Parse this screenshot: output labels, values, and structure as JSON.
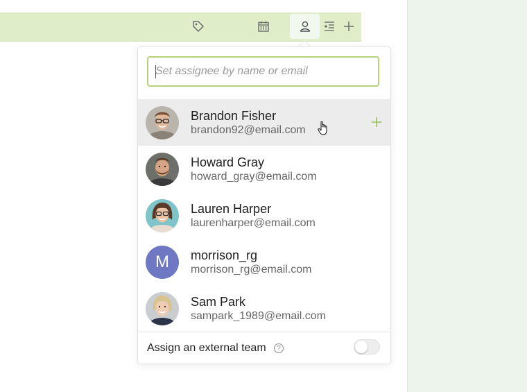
{
  "toolbar": {
    "icons": [
      "tag-icon",
      "calendar-icon",
      "person-icon",
      "list-indent-icon",
      "plus-icon"
    ],
    "active": "person-icon",
    "bg_color": "#dfeec8"
  },
  "assignee_picker": {
    "search_placeholder": "Set assignee by name or email",
    "search_value": "",
    "accent_color": "#b4d27d",
    "hovered_index": 0,
    "people": [
      {
        "name": "Brandon Fisher",
        "email": "brandon92@email.com",
        "avatar": "photo"
      },
      {
        "name": "Howard Gray",
        "email": "howard_gray@email.com",
        "avatar": "photo"
      },
      {
        "name": "Lauren Harper",
        "email": "laurenharper@email.com",
        "avatar": "photo"
      },
      {
        "name": "morrison_rg",
        "email": "morrison_rg@email.com",
        "avatar": "M",
        "avatar_color": "#6f78c2"
      },
      {
        "name": "Sam Park",
        "email": "sampark_1989@email.com",
        "avatar": "photo"
      }
    ],
    "footer": {
      "label": "Assign an external team",
      "help": "?",
      "toggle_on": false
    }
  }
}
